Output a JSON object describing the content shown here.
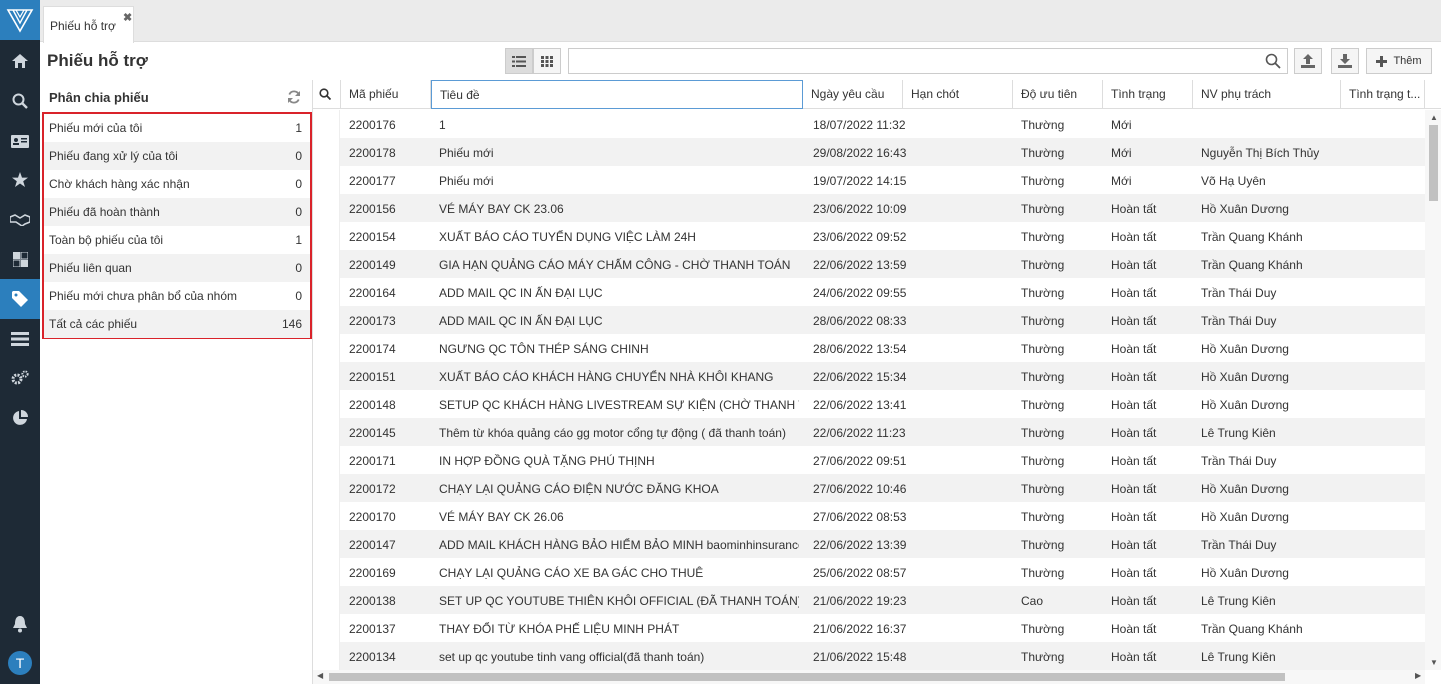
{
  "tab": {
    "label": "Phiếu hỗ trợ",
    "close": "✖"
  },
  "page_title": "Phiếu hỗ trợ",
  "search": {
    "value": "",
    "placeholder": ""
  },
  "toolbar": {
    "add_label": "Thêm"
  },
  "left_panel": {
    "title": "Phân chia phiếu",
    "categories": [
      {
        "name": "Phiếu mới của tôi",
        "count": "1"
      },
      {
        "name": "Phiếu đang xử lý của tôi",
        "count": "0"
      },
      {
        "name": "Chờ khách hàng xác nhận",
        "count": "0"
      },
      {
        "name": "Phiếu đã hoàn thành",
        "count": "0"
      },
      {
        "name": "Toàn bộ phiếu của tôi",
        "count": "1"
      },
      {
        "name": "Phiếu liên quan",
        "count": "0"
      },
      {
        "name": "Phiếu mới chưa phân bổ của nhóm",
        "count": "0"
      },
      {
        "name": "Tất cả các phiếu",
        "count": "146"
      }
    ]
  },
  "table": {
    "columns": [
      "Mã phiếu",
      "Tiêu đề",
      "Ngày yêu cầu",
      "Hạn chót",
      "Độ ưu tiên",
      "Tình trạng",
      "NV phụ trách",
      "Tình trạng t..."
    ],
    "rows": [
      [
        "2200176",
        "1",
        "18/07/2022 11:32",
        "",
        "Thường",
        "Mới",
        ""
      ],
      [
        "2200178",
        "Phiếu mới",
        "29/08/2022 16:43",
        "",
        "Thường",
        "Mới",
        "Nguyễn Thị Bích Thủy"
      ],
      [
        "2200177",
        "Phiếu mới",
        "19/07/2022 14:15",
        "",
        "Thường",
        "Mới",
        "Võ Hạ Uyên"
      ],
      [
        "2200156",
        "VÉ MÁY BAY CK 23.06",
        "23/06/2022 10:09",
        "",
        "Thường",
        "Hoàn tất",
        "Hồ Xuân Dương"
      ],
      [
        "2200154",
        "XUẤT BÁO CÁO TUYỂN DỤNG VIỆC LÀM 24H",
        "23/06/2022 09:52",
        "",
        "Thường",
        "Hoàn tất",
        "Trần Quang Khánh"
      ],
      [
        "2200149",
        "GIA HẠN QUẢNG CÁO MÁY CHẤM CÔNG - CHỜ THANH TOÁN",
        "22/06/2022 13:59",
        "",
        "Thường",
        "Hoàn tất",
        "Trần Quang Khánh"
      ],
      [
        "2200164",
        "ADD MAIL QC IN ẤN ĐẠI LỤC",
        "24/06/2022 09:55",
        "",
        "Thường",
        "Hoàn tất",
        "Trần Thái Duy"
      ],
      [
        "2200173",
        "ADD MAIL QC IN ẤN ĐẠI LỤC",
        "28/06/2022 08:33",
        "",
        "Thường",
        "Hoàn tất",
        "Trần Thái Duy"
      ],
      [
        "2200174",
        "NGƯNG QC TÔN THÉP SÁNG CHINH",
        "28/06/2022 13:54",
        "",
        "Thường",
        "Hoàn tất",
        "Hồ Xuân Dương"
      ],
      [
        "2200151",
        "XUẤT BÁO CÁO KHÁCH HÀNG CHUYỂN NHÀ KHÔI KHANG",
        "22/06/2022 15:34",
        "",
        "Thường",
        "Hoàn tất",
        "Hồ Xuân Dương"
      ],
      [
        "2200148",
        "SETUP QC KHÁCH HÀNG LIVESTREAM SỰ KIỆN (CHỜ THANH TO...",
        "22/06/2022 13:41",
        "",
        "Thường",
        "Hoàn tất",
        "Hồ Xuân Dương"
      ],
      [
        "2200145",
        "Thêm từ khóa quảng cáo gg motor cổng tự động ( đã thanh toán)",
        "22/06/2022 11:23",
        "",
        "Thường",
        "Hoàn tất",
        "Lê Trung Kiên"
      ],
      [
        "2200171",
        "IN HỢP ĐỒNG QUÀ TẶNG PHÚ THỊNH",
        "27/06/2022 09:51",
        "",
        "Thường",
        "Hoàn tất",
        "Trần Thái Duy"
      ],
      [
        "2200172",
        "CHẠY LẠI QUẢNG CÁO ĐIỆN NƯỚC ĐĂNG KHOA",
        "27/06/2022 10:46",
        "",
        "Thường",
        "Hoàn tất",
        "Hồ Xuân Dương"
      ],
      [
        "2200170",
        "VÉ MÁY BAY CK 26.06",
        "27/06/2022 08:53",
        "",
        "Thường",
        "Hoàn tất",
        "Hồ Xuân Dương"
      ],
      [
        "2200147",
        "ADD MAIL KHÁCH HÀNG BẢO HIỂM BẢO MINH baominhinsurance.com",
        "22/06/2022 13:39",
        "",
        "Thường",
        "Hoàn tất",
        "Trần Thái Duy"
      ],
      [
        "2200169",
        "CHẠY LẠI QUẢNG CÁO XE BA GÁC CHO THUÊ",
        "25/06/2022 08:57",
        "",
        "Thường",
        "Hoàn tất",
        "Hồ Xuân Dương"
      ],
      [
        "2200138",
        "SET UP QC YOUTUBE THIÊN KHÔI OFFICIAL (ĐÃ THANH TOÁN)",
        "21/06/2022 19:23",
        "",
        "Cao",
        "Hoàn tất",
        "Lê Trung Kiên"
      ],
      [
        "2200137",
        "THAY ĐỔI TỪ KHÓA PHẾ LIỆU MINH PHÁT",
        "21/06/2022 16:37",
        "",
        "Thường",
        "Hoàn tất",
        "Trần Quang Khánh"
      ],
      [
        "2200134",
        "set up qc youtube tinh vang official(đã thanh toán)",
        "21/06/2022 15:48",
        "",
        "Thường",
        "Hoàn tất",
        "Lê Trung Kiên"
      ]
    ]
  },
  "sidebar_icons": [
    "logo-icon",
    "home-icon",
    "search-icon",
    "contact-card-icon",
    "star-icon",
    "handshake-icon",
    "dashboard-icon",
    "tag-icon",
    "list-icon",
    "settings-icon",
    "pie-chart-icon",
    "bell-icon"
  ],
  "user": {
    "initial": "T"
  },
  "colors": {
    "rail": "#1e2a36",
    "accent": "#2c7fbd",
    "highlight_border": "#d9232a"
  }
}
